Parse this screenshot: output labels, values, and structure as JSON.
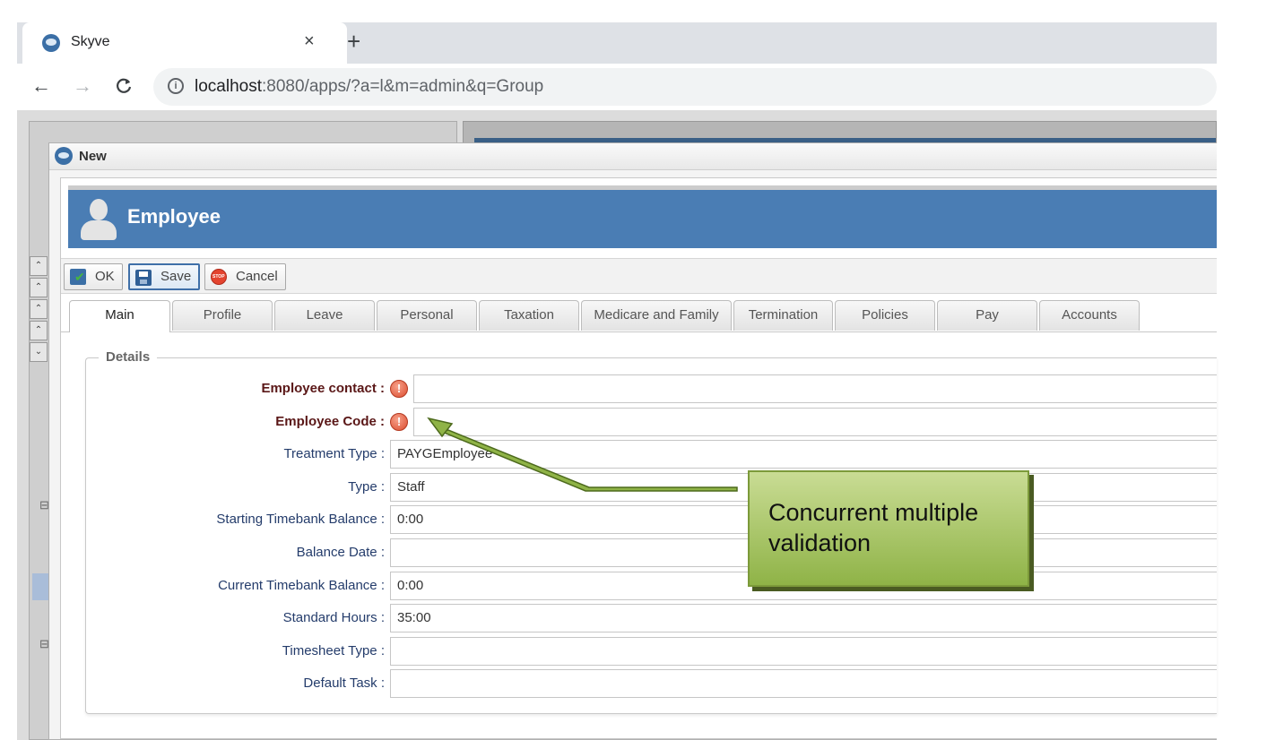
{
  "browser": {
    "tab_title": "Skyve",
    "tab_close": "×",
    "new_tab": "+",
    "back": "←",
    "forward": "→",
    "reload": "C",
    "url_host": "localhost",
    "url_rest": ":8080/apps/?a=l&m=admin&q=Group",
    "info": "i"
  },
  "dialog": {
    "title": "New",
    "header_title": "Employee",
    "toolbar": {
      "ok_label": "OK",
      "save_label": "Save",
      "cancel_label": "Cancel"
    },
    "tabs": [
      "Main",
      "Profile",
      "Leave",
      "Personal",
      "Taxation",
      "Medicare and Family",
      "Termination",
      "Policies",
      "Pay",
      "Accounts"
    ],
    "selected_tab": "Main",
    "fieldset_legend": "Details",
    "fields": [
      {
        "label": "Employee contact :",
        "value": "",
        "required": true,
        "error": "!"
      },
      {
        "label": "Employee Code :",
        "value": "",
        "required": true,
        "error": "!"
      },
      {
        "label": "Treatment Type :",
        "value": "PAYGEmployee"
      },
      {
        "label": "Type :",
        "value": "Staff"
      },
      {
        "label": "Starting Timebank Balance :",
        "value": "0:00"
      },
      {
        "label": "Balance Date :",
        "value": ""
      },
      {
        "label": "Current Timebank Balance :",
        "value": "0:00"
      },
      {
        "label": "Standard Hours :",
        "value": "35:00"
      },
      {
        "label": "Timesheet Type :",
        "value": ""
      },
      {
        "label": "Default Task :",
        "value": ""
      }
    ]
  },
  "annotation": {
    "text": "Concurrent multiple validation"
  },
  "colors": {
    "header_band": "#4a7db4",
    "required_label": "#5a1717",
    "field_label": "#243c6b",
    "callout_fill": "#a8c464",
    "error_icon": "#dc4c2f"
  }
}
